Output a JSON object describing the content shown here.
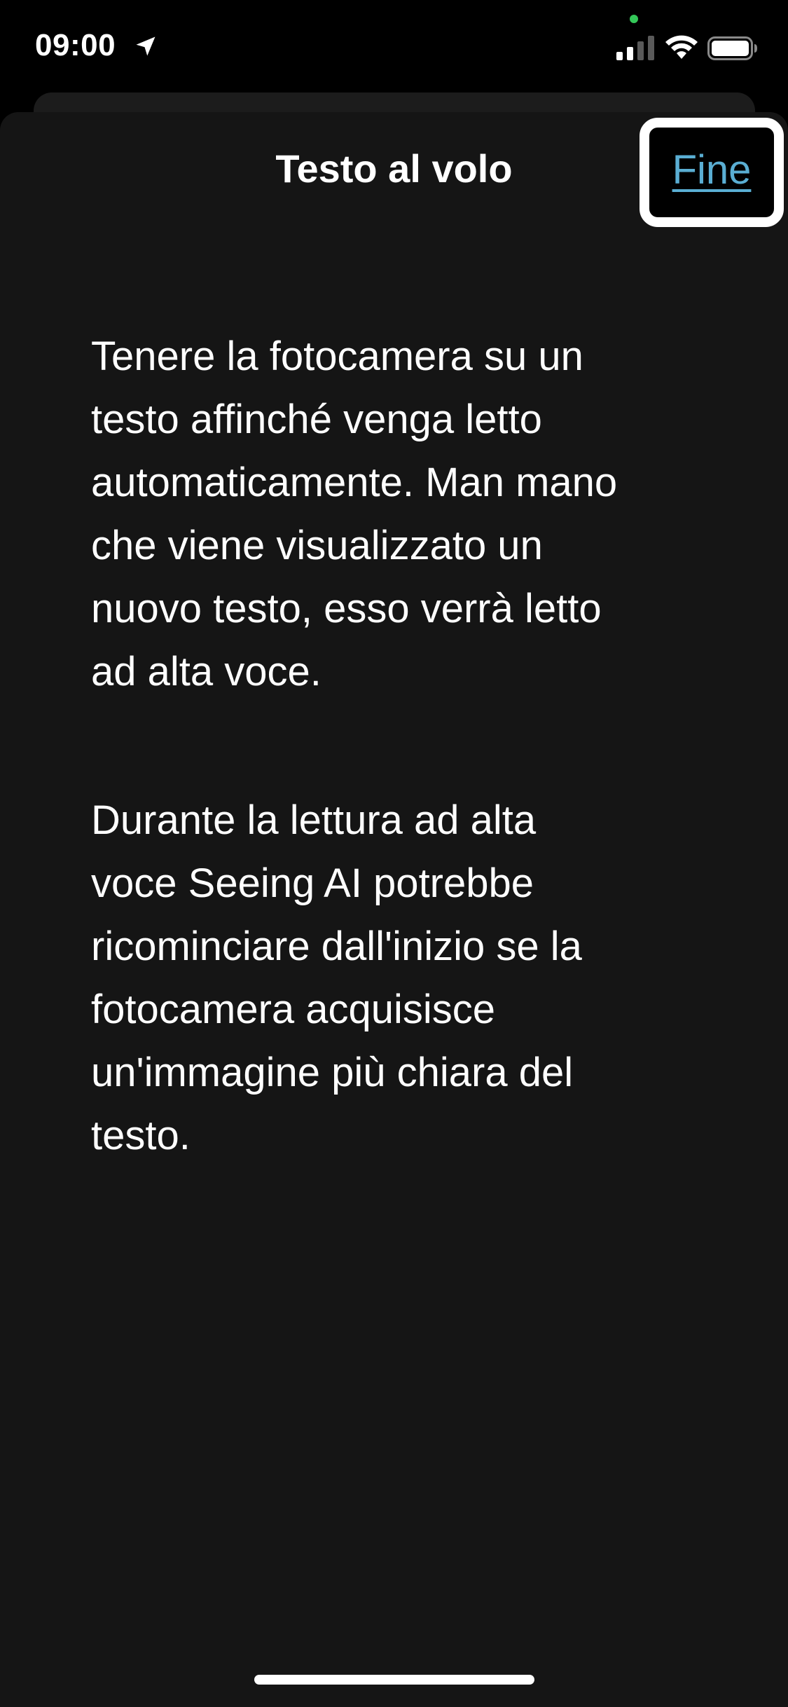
{
  "status_bar": {
    "time": "09:00",
    "icons": [
      "location-arrow-icon",
      "signal-icon",
      "wifi-icon",
      "battery-icon"
    ],
    "privacy_dot_color": "#34c759"
  },
  "sheet": {
    "title": "Testo al volo",
    "done_label": "Fine"
  },
  "content": {
    "paragraphs": [
      "Tenere la fotocamera su un\ntesto affinché venga letto\nautomaticamente. Man mano\nche viene visualizzato un\nnuovo testo, esso verrà letto\nad alta voce.",
      "Durante la lettura ad alta\nvoce Seeing AI potrebbe\nricominciare dall'inizio se la\nfotocamera acquisisce\nun'immagine più chiara del\ntesto."
    ]
  },
  "colors": {
    "background": "#000000",
    "sheet": "#151515",
    "link": "#5aaed3",
    "text": "#ffffff"
  }
}
